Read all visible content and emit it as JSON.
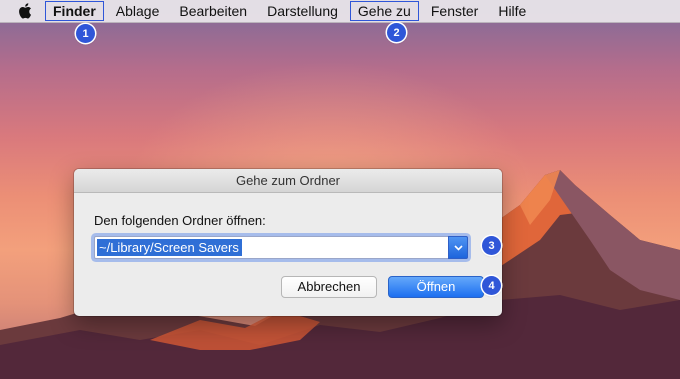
{
  "menubar": {
    "apple_icon": "apple-icon",
    "items": [
      {
        "label": "Finder",
        "bold": true,
        "highlighted": true,
        "badge": "1"
      },
      {
        "label": "Ablage"
      },
      {
        "label": "Bearbeiten"
      },
      {
        "label": "Darstellung"
      },
      {
        "label": "Gehe zu",
        "highlighted": true,
        "badge": "2"
      },
      {
        "label": "Fenster"
      },
      {
        "label": "Hilfe"
      }
    ]
  },
  "dialog": {
    "title": "Gehe zum Ordner",
    "prompt": "Den folgenden Ordner öffnen:",
    "path_value": "~/Library/Screen Savers",
    "dropdown_icon": "chevron-down-icon",
    "dropdown_badge": "3",
    "cancel_label": "Abbrechen",
    "open_label": "Öffnen",
    "open_badge": "4"
  },
  "colors": {
    "badge": "#2f56d8",
    "highlight_outline": "#2f56d8",
    "primary_button": "#1c6ff0",
    "selection": "#2f6fd6"
  }
}
